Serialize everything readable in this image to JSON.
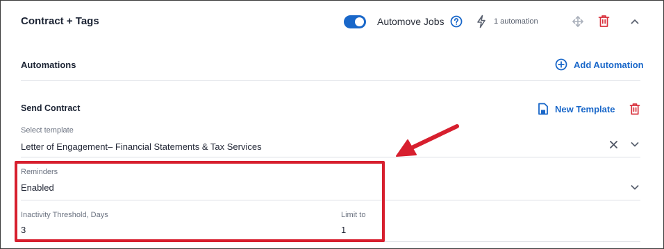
{
  "card": {
    "title": "Contract  + Tags",
    "automove_label": "Automove Jobs",
    "automove_enabled": true,
    "automation_count": "1 automation"
  },
  "automations": {
    "heading": "Automations",
    "add_label": "Add Automation"
  },
  "send_contract": {
    "title": "Send Contract",
    "new_template_label": "New Template",
    "template": {
      "label": "Select template",
      "value": "Letter of Engagement– Financial Statements & Tax Services"
    },
    "reminders": {
      "label": "Reminders",
      "value": "Enabled"
    },
    "inactivity": {
      "label": "Inactivity Threshold, Days",
      "value": "3"
    },
    "limit": {
      "label": "Limit to",
      "value": "1"
    }
  },
  "colors": {
    "accent": "#1967c9",
    "danger": "#d9333f",
    "annotation": "#d71f2e"
  }
}
